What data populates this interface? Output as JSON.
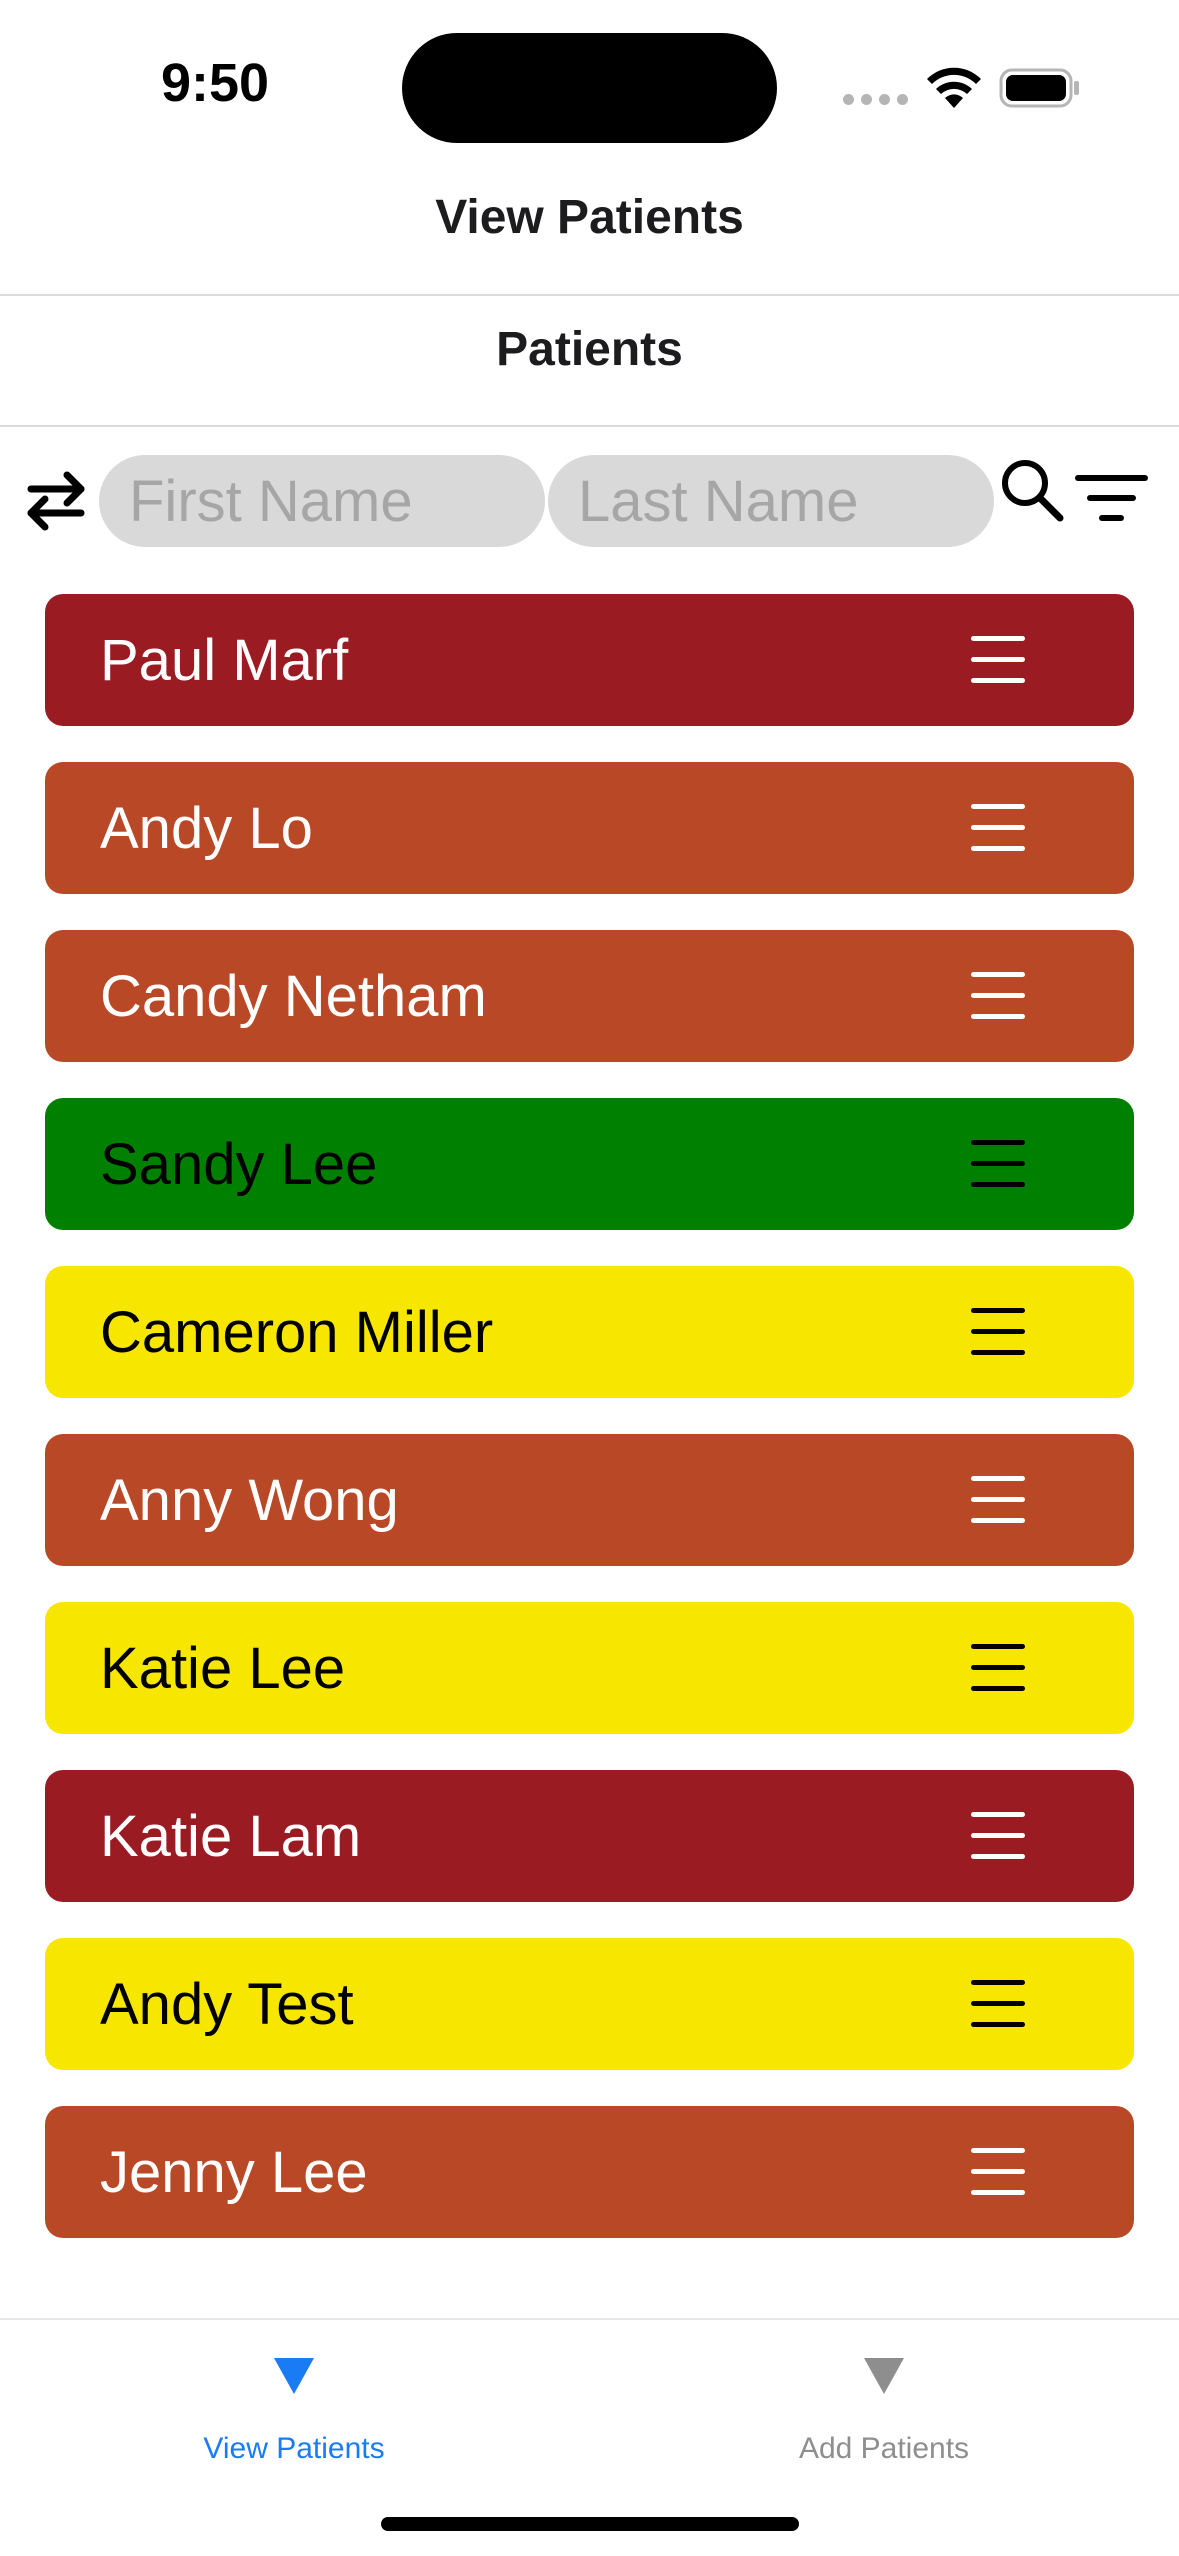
{
  "status_bar": {
    "time": "9:50",
    "icons": [
      "signal-dots-icon",
      "wifi-icon",
      "battery-icon"
    ]
  },
  "header": {
    "title": "View Patients"
  },
  "section": {
    "title": "Patients"
  },
  "search": {
    "first_name_placeholder": "First Name",
    "last_name_placeholder": "Last Name",
    "first_name_value": "",
    "last_name_value": "",
    "icons": [
      "swap-icon",
      "search-icon",
      "filter-icon"
    ]
  },
  "colors": {
    "red": "#9b1b23",
    "orange": "#b94826",
    "green": "#008000",
    "yellow": "#f6e600",
    "tab_active": "#1a7cf4",
    "tab_inactive": "#8e8e8e"
  },
  "patients": [
    {
      "name": "Paul Marf",
      "color": "#9b1b23",
      "text_color": "#ffffff"
    },
    {
      "name": "Andy Lo",
      "color": "#b94826",
      "text_color": "#ffffff"
    },
    {
      "name": "Candy Netham",
      "color": "#b94826",
      "text_color": "#ffffff"
    },
    {
      "name": "Sandy Lee",
      "color": "#008000",
      "text_color": "#000000"
    },
    {
      "name": "Cameron Miller",
      "color": "#f6e600",
      "text_color": "#000000"
    },
    {
      "name": "Anny Wong",
      "color": "#b94826",
      "text_color": "#ffffff"
    },
    {
      "name": "Katie Lee",
      "color": "#f6e600",
      "text_color": "#000000"
    },
    {
      "name": "Katie Lam",
      "color": "#9b1b23",
      "text_color": "#ffffff"
    },
    {
      "name": "Andy Test",
      "color": "#f6e600",
      "text_color": "#000000"
    },
    {
      "name": "Jenny Lee",
      "color": "#b94826",
      "text_color": "#ffffff"
    }
  ],
  "tab_bar": {
    "tabs": [
      {
        "label": "View Patients",
        "icon": "triangle-down-icon",
        "active": true
      },
      {
        "label": "Add Patients",
        "icon": "triangle-down-icon",
        "active": false
      }
    ]
  }
}
